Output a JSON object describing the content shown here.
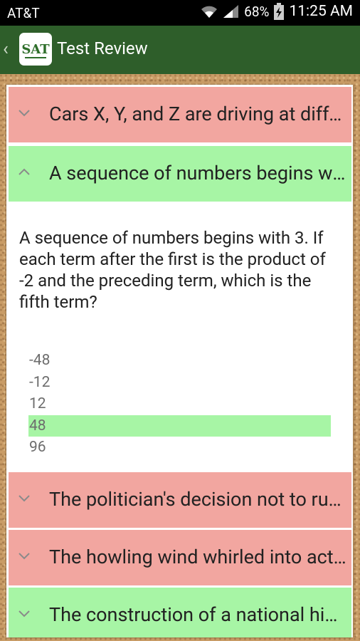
{
  "status": {
    "carrier": "AT&T",
    "battery": "68%",
    "time": "11:25 AM"
  },
  "app": {
    "logo_text": "SAT",
    "title": "Test Review"
  },
  "questions": [
    {
      "summary": "Cars X, Y, and Z are driving at different speeds and in different directions for some time.",
      "result": "incorrect",
      "color": "#f2a6a0"
    },
    {
      "summary": "A sequence of numbers begins with 3. If each term after the first is the product",
      "result": "correct",
      "color": "#a7f5a5",
      "expanded": true,
      "full_text": "A sequence of numbers begins with 3. If each term after the first is the product of -2 and the preceding term, which is the fifth term?",
      "options": [
        "-48",
        "-12",
        "12",
        "48",
        "96"
      ],
      "selected_index": 3
    },
    {
      "summary": "The politician's decision not to run for office again",
      "result": "incorrect",
      "color": "#f2a6a0"
    },
    {
      "summary": "The howling wind whirled into action",
      "result": "incorrect",
      "color": "#f2a6a0"
    },
    {
      "summary": "The construction of a national highway",
      "result": "correct",
      "color": "#a7f5a5"
    }
  ],
  "colors": {
    "action_bar": "#2e5e2a",
    "incorrect": "#f2a6a0",
    "correct": "#a7f5a5"
  }
}
